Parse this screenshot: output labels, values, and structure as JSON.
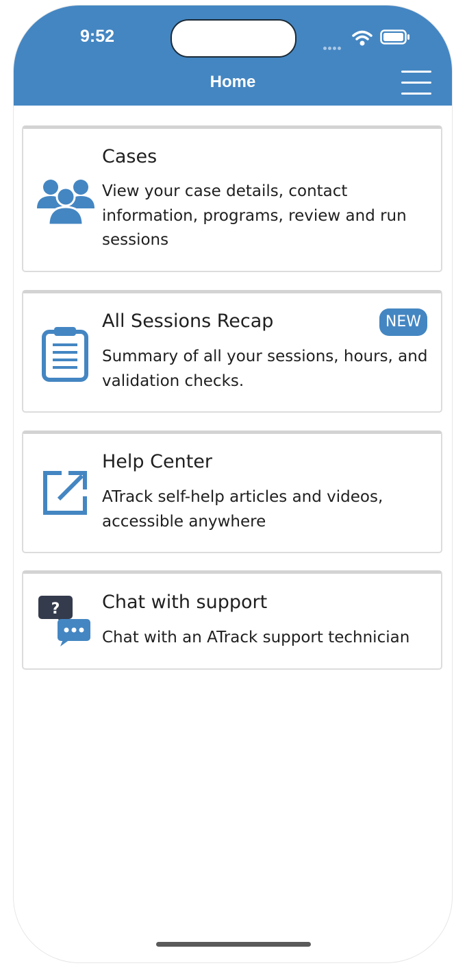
{
  "status_bar": {
    "time": "9:52"
  },
  "header": {
    "title": "Home"
  },
  "cards": [
    {
      "title": "Cases",
      "description": "View your case details, contact information, programs, review and run sessions",
      "icon": "users-icon"
    },
    {
      "title": "All Sessions Recap",
      "description": "Summary of all your sessions, hours, and validation checks.",
      "badge": "NEW",
      "icon": "clipboard-icon"
    },
    {
      "title": "Help Center",
      "description": "ATrack self-help articles and videos, accessible anywhere",
      "icon": "external-link-icon"
    },
    {
      "title": "Chat with support",
      "description": "Chat with an ATrack support technician",
      "icon": "chat-support-icon"
    }
  ],
  "colors": {
    "header": "#4486c2",
    "accent": "#4486c2",
    "chat_dark": "#343b4c"
  }
}
